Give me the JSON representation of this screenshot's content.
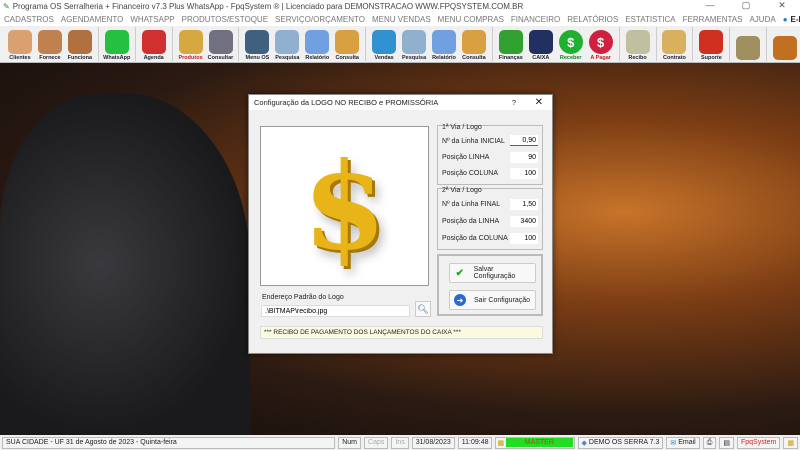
{
  "window": {
    "title": "Programa OS Serralheria + Financeiro v7.3 Plus WhatsApp - FpqSystem ® | Licenciado para  DEMONSTRACAO WWW.FPQSYSTEM.COM.BR",
    "minimize": "—",
    "maximize": "▢",
    "close": "✕"
  },
  "menu": [
    "CADASTROS",
    "AGENDAMENTO",
    "WHATSAPP",
    "PRODUTOS/ESTOQUE",
    "SERVIÇO/ORÇAMENTO",
    "MENU VENDAS",
    "MENU COMPRAS",
    "FINANCEIRO",
    "RELATÓRIOS",
    "ESTATISTICA",
    "FERRAMENTAS",
    "AJUDA",
    "E-MAIL"
  ],
  "toolbar": [
    {
      "label": "Clientes",
      "icon": "clients-icon",
      "color": "#d9a070"
    },
    {
      "label": "Fornece",
      "icon": "supplier-icon",
      "color": "#c08050"
    },
    {
      "label": "Funciona",
      "icon": "employee-icon",
      "color": "#b07040"
    },
    {
      "label": "WhatsApp",
      "icon": "whatsapp-icon",
      "color": "#25c040"
    },
    {
      "label": "Agenda",
      "icon": "calendar-icon",
      "color": "#d03030"
    },
    {
      "label": "Produtos",
      "icon": "boxes-icon",
      "color": "#d8a840"
    },
    {
      "label": "Consultar",
      "icon": "barcode-icon",
      "color": "#707080"
    },
    {
      "label": "Menu OS",
      "icon": "clipboard-icon",
      "color": "#406080"
    },
    {
      "label": "Pesquisa",
      "icon": "search-docs-icon",
      "color": "#90b0d0"
    },
    {
      "label": "Relatório",
      "icon": "printer-icon",
      "color": "#70a0e0"
    },
    {
      "label": "Consulta",
      "icon": "drawer-icon",
      "color": "#d8a040"
    },
    {
      "label": "Vendas",
      "icon": "monitor-icon",
      "color": "#3090d0"
    },
    {
      "label": "Pesquisa",
      "icon": "search-docs-icon",
      "color": "#90b0d0"
    },
    {
      "label": "Relatório",
      "icon": "printer-icon",
      "color": "#70a0e0"
    },
    {
      "label": "Consulta",
      "icon": "drawer-icon",
      "color": "#d8a040"
    },
    {
      "label": "Finanças",
      "icon": "finance-chart-icon",
      "color": "#30a030"
    },
    {
      "label": "CAIXA",
      "icon": "cashbook-icon",
      "color": "#203060"
    },
    {
      "label": "Receber",
      "icon": "receive-dollar-icon",
      "color": "#20b030"
    },
    {
      "label": "A Pagar",
      "icon": "pay-dollar-icon",
      "color": "#d02040"
    },
    {
      "label": "Recibo",
      "icon": "receipt-icon",
      "color": "#c0c0a0"
    },
    {
      "label": "Contrato",
      "icon": "contract-icon",
      "color": "#d8b060"
    },
    {
      "label": "Suporte",
      "icon": "support-icon",
      "color": "#d03020"
    },
    {
      "label": "",
      "icon": "coins-icon",
      "color": "#a09060"
    },
    {
      "label": "",
      "icon": "exit-door-icon",
      "color": "#c07020"
    }
  ],
  "dialog": {
    "title": "Configuração da LOGO NO RECIBO e PROMISSÓRIA",
    "help": "?",
    "close": "✕",
    "via1": {
      "legend": "1ª Via / Logo",
      "fields": [
        {
          "label": "Nº da Linha INICIAL",
          "value": "0,90"
        },
        {
          "label": "Posição LINHA",
          "value": "90"
        },
        {
          "label": "Posição COLUNA",
          "value": "100"
        }
      ]
    },
    "via2": {
      "legend": "2ª Via / Logo",
      "fields": [
        {
          "label": "Nº da Linha FINAL",
          "value": "1,50"
        },
        {
          "label": "Posição da LINHA",
          "value": "3400"
        },
        {
          "label": "Posição da COLUNA",
          "value": "100"
        }
      ]
    },
    "save_label": "Salvar Configuração",
    "exit_label": "Sair Configuração",
    "path_label": "Endereço Padrão do Logo",
    "path_value": ".\\BITMAP\\recibo.jpg",
    "banner": "*** RECIBO DE PAGAMENTO DOS LANÇAMENTOS DO CAIXA ***"
  },
  "status": {
    "city": "SUA CIDADE - UF 31 de Agosto de 2023 - Quinta-feira",
    "num": "Num",
    "caps": "Caps",
    "ins": "Ins",
    "date": "31/08/2023",
    "time": "11:09:48",
    "user": "MASTER",
    "db": "DEMO OS SERRA 7.3",
    "email": "Email",
    "brand": "FpqSystem",
    "user_color": "#22dd22"
  }
}
